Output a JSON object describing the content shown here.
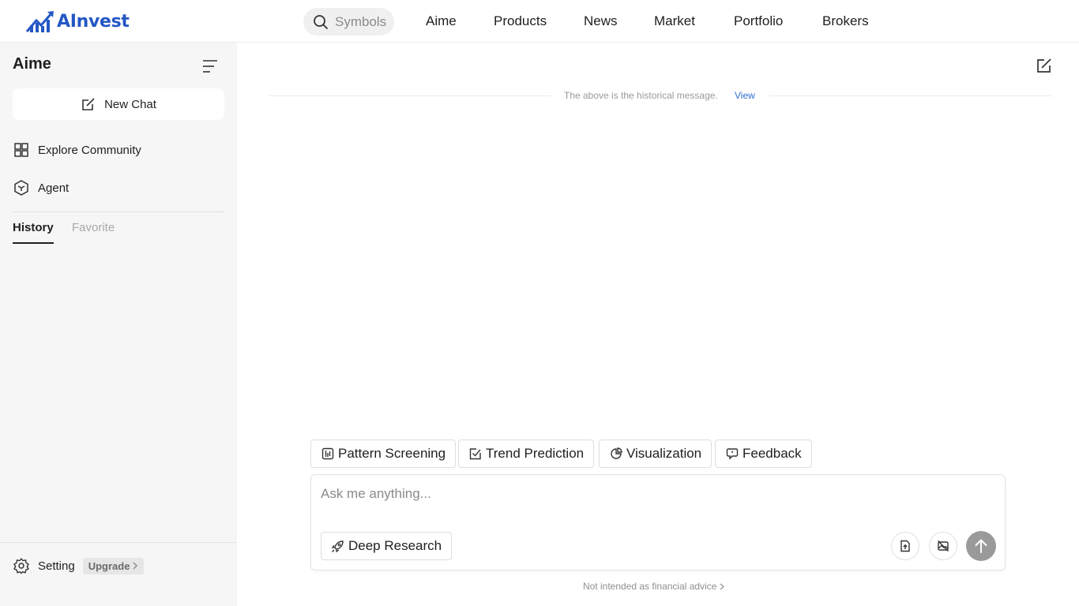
{
  "brand": {
    "name": "AInvest",
    "color": "#2457c5"
  },
  "search": {
    "label": "Symbols"
  },
  "nav": {
    "items": [
      {
        "label": "Aime"
      },
      {
        "label": "Products"
      },
      {
        "label": "News"
      },
      {
        "label": "Market"
      },
      {
        "label": "Portfolio"
      },
      {
        "label": "Brokers"
      }
    ]
  },
  "sidebar": {
    "title": "Aime",
    "new_chat": "New Chat",
    "items": [
      {
        "label": "Explore Community",
        "icon": "grid-icon"
      },
      {
        "label": "Agent",
        "icon": "cube-icon"
      }
    ],
    "tabs": [
      {
        "label": "History",
        "active": true
      },
      {
        "label": "Favorite",
        "active": false
      }
    ],
    "setting": "Setting",
    "upgrade": "Upgrade"
  },
  "main": {
    "history_notice": "The above is the historical message.",
    "view_link": "View",
    "chips": [
      {
        "label": "Pattern Screening",
        "icon": "pattern-icon"
      },
      {
        "label": "Trend Prediction",
        "icon": "trend-check-icon"
      },
      {
        "label": "Visualization",
        "icon": "pie-icon"
      },
      {
        "label": "Feedback",
        "icon": "feedback-icon"
      }
    ],
    "composer": {
      "placeholder": "Ask me anything...",
      "deep_research": "Deep Research"
    },
    "disclaimer": "Not intended as financial advice"
  },
  "colors": {
    "link": "#2f6fd0",
    "send_disabled": "#9a9a9a",
    "sidebar_bg": "#f6f6f6"
  }
}
